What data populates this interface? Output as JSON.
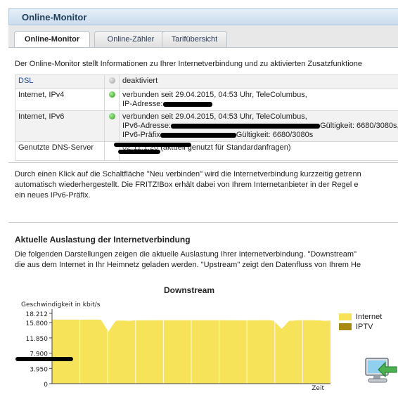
{
  "window": {
    "title": "Online-Monitor"
  },
  "tabs": [
    {
      "label": "Online-Monitor",
      "active": true
    },
    {
      "label": "Online-Zähler",
      "active": false
    },
    {
      "label": "Tarifübersicht",
      "active": false
    }
  ],
  "intro": "Der Online-Monitor stellt Informationen zu Ihrer Internetverbindung und zu aktivierten Zusatzfunktione",
  "status": {
    "dsl": {
      "label": "DSL",
      "state": "grey",
      "text": "deaktiviert"
    },
    "ipv4": {
      "label": "Internet, IPv4",
      "state": "green",
      "line1": "verbunden seit 29.04.2015, 04:53 Uhr, TeleColumbus,",
      "line2": "IP-Adresse:"
    },
    "ipv6": {
      "label": "Internet, IPv6",
      "state": "green",
      "line1": "verbunden seit 29.04.2015, 04:53 Uhr, TeleColumbus,",
      "line2a": "IPv6-Adresse:",
      "line2b": "Gültigkeit: 6680/3080s,",
      "line3a": "IPv6-Präfix",
      "line3b": "Gültigkeit: 6680/3080s"
    },
    "dns": {
      "label": "Genutzte DNS-Server",
      "ip_fragment": "02.11.1.20",
      "text": "(aktuell genutzt für Standardanfragen)"
    }
  },
  "reconnect_text": [
    "Durch einen Klick auf die Schaltfläche \"Neu verbinden\" wird die Internetverbindung kurzzeitig getrenn",
    "automatisch wiederhergestellt. Die FRITZ!Box erhält dabei von Ihrem Internetanbieter in der Regel e",
    "ein neues IPv6-Präfix."
  ],
  "section_heading": "Aktuelle Auslastung der Internetverbindung",
  "section_text": [
    "Die folgenden Darstellungen zeigen die aktuelle Auslastung Ihrer Internetverbindung. \"Downstream\"",
    "die aus dem Internet in Ihr Heimnetz geladen werden. \"Upstream\" zeigt den Datenfluss von Ihrem He"
  ],
  "colors": {
    "internet": "#f7e35a",
    "iptv": "#a88a12",
    "accent": "#1f3e5a"
  },
  "chart_data": {
    "type": "area",
    "title": "Downstream",
    "ylabel": "Geschwindigkeit in kbit/s",
    "xlabel": "Zeit",
    "ylim": [
      0,
      18212
    ],
    "yticks": [
      "18.212",
      "15.800",
      "11.850",
      "7.900",
      "3.950",
      "0"
    ],
    "ytick_values": [
      18212,
      15800,
      11850,
      7900,
      3950,
      0
    ],
    "legend": [
      "Internet",
      "IPTV"
    ],
    "legend_position": "right",
    "series": [
      {
        "name": "Internet",
        "values": [
          16600,
          16600,
          16600,
          16600,
          16600,
          16600,
          16600,
          16600,
          16600,
          16600,
          16600,
          16600,
          16600,
          16550,
          15000,
          13500,
          15000,
          16300,
          16350,
          16350,
          16300,
          16300,
          16400,
          16400,
          16400,
          16400,
          16400,
          16400,
          16450,
          16450,
          16450,
          16450,
          16450,
          16450,
          16450,
          16450,
          16450,
          16450,
          16450,
          16450,
          16450,
          16450,
          16450,
          16450,
          16450,
          16450,
          16450,
          16400,
          16400,
          16400,
          16400,
          16400,
          16400,
          16400,
          16400,
          16400,
          16450,
          16450,
          16450,
          16300,
          15200,
          14200,
          15200,
          16300,
          16300,
          16400,
          16450,
          16450,
          16450,
          16450,
          16400,
          16400,
          16300,
          16300,
          16350
        ]
      },
      {
        "name": "IPTV",
        "values": [
          0
        ]
      }
    ]
  }
}
